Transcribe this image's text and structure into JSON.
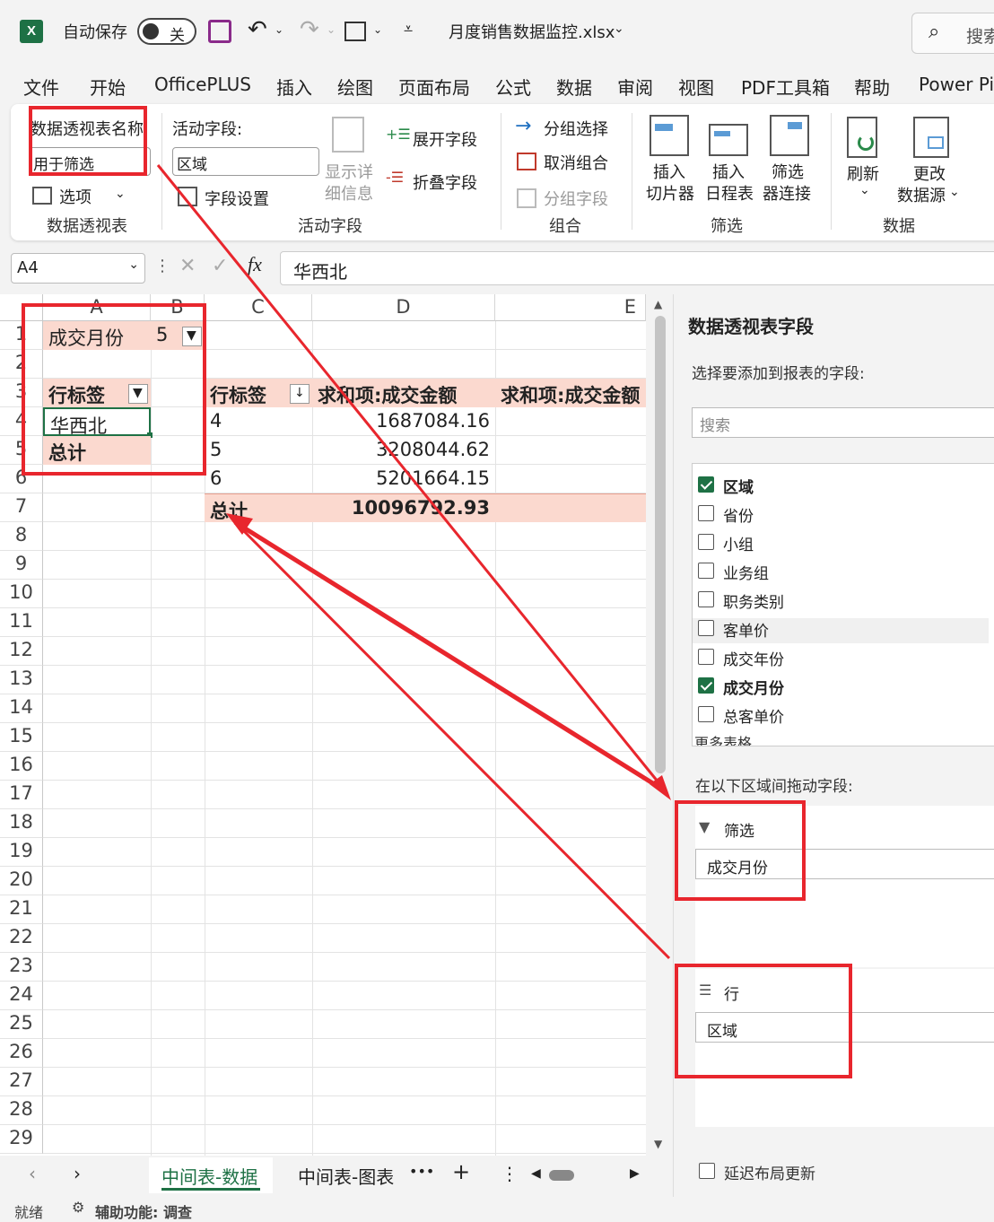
{
  "titlebar": {
    "autosave_label": "自动保存",
    "autosave_state": "关",
    "filename": "月度销售数据监控.xlsx",
    "search_placeholder": "搜索"
  },
  "menu": [
    "文件",
    "开始",
    "OfficePLUS",
    "插入",
    "绘图",
    "页面布局",
    "公式",
    "数据",
    "审阅",
    "视图",
    "PDF工具箱",
    "帮助",
    "Power Pi"
  ],
  "ribbon": {
    "pivot_name_label": "数据透视表名称:",
    "pivot_name_value": "用于筛选",
    "options_label": "选项",
    "group_pivot": "数据透视表",
    "active_field_label": "活动字段:",
    "active_field_value": "区域",
    "field_settings": "字段设置",
    "drill_details_1": "显示详",
    "drill_details_2": "细信息",
    "expand_field": "展开字段",
    "collapse_field": "折叠字段",
    "group_active": "活动字段",
    "group_selection": "分组选择",
    "ungroup": "取消组合",
    "group_field": "分组字段",
    "group_group": "组合",
    "insert_slicer_1": "插入",
    "insert_slicer_2": "切片器",
    "insert_timeline_1": "插入",
    "insert_timeline_2": "日程表",
    "filter_conn_1": "筛选",
    "filter_conn_2": "器连接",
    "group_filter": "筛选",
    "refresh": "刷新",
    "change_source_1": "更改",
    "change_source_2": "数据源",
    "group_data": "数据"
  },
  "formula": {
    "cell_ref": "A4",
    "content": "华西北"
  },
  "grid": {
    "columns": [
      "A",
      "B",
      "C",
      "D",
      "E"
    ],
    "rows": [
      "1",
      "2",
      "3",
      "4",
      "5",
      "6",
      "7",
      "8",
      "9",
      "10",
      "11",
      "12",
      "13",
      "14",
      "15",
      "16",
      "17",
      "18",
      "19",
      "20",
      "21",
      "22",
      "23",
      "24",
      "25",
      "26",
      "27",
      "28",
      "29"
    ],
    "a1": "成交月份",
    "b1": "5",
    "a3": "行标签",
    "a4": "华西北",
    "a5": "总计",
    "c3": "行标签",
    "d3": "求和项:成交金额",
    "e3": "求和项:成交金额",
    "c4": "4",
    "d4": "1687084.16",
    "c5": "5",
    "d5": "3208044.62",
    "c6": "6",
    "d6": "5201664.15",
    "c7": "总计",
    "d7": "10096792.93"
  },
  "sheets": {
    "active": "中间表-数据",
    "other": "中间表-图表"
  },
  "status": {
    "ready": "就绪",
    "accessibility": "辅助功能: 调查"
  },
  "pane": {
    "title": "数据透视表字段",
    "choose_text": "选择要添加到报表的字段:",
    "search_placeholder": "搜索",
    "fields": [
      {
        "name": "区域",
        "checked": true
      },
      {
        "name": "省份",
        "checked": false
      },
      {
        "name": "小组",
        "checked": false
      },
      {
        "name": "业务组",
        "checked": false
      },
      {
        "name": "职务类别",
        "checked": false
      },
      {
        "name": "客单价",
        "checked": false
      },
      {
        "name": "成交年份",
        "checked": false
      },
      {
        "name": "成交月份",
        "checked": true
      },
      {
        "name": "总客单价",
        "checked": false
      }
    ],
    "more_tables": "更多表格...",
    "drag_text": "在以下区域间拖动字段:",
    "filter_label": "筛选",
    "filter_item": "成交月份",
    "rows_label": "行",
    "rows_item": "区域",
    "defer_label": "延迟布局更新"
  },
  "colors": {
    "accent_red": "#e8262d",
    "pivot_pink": "#fbd9cf",
    "excel_green": "#1e7145"
  }
}
